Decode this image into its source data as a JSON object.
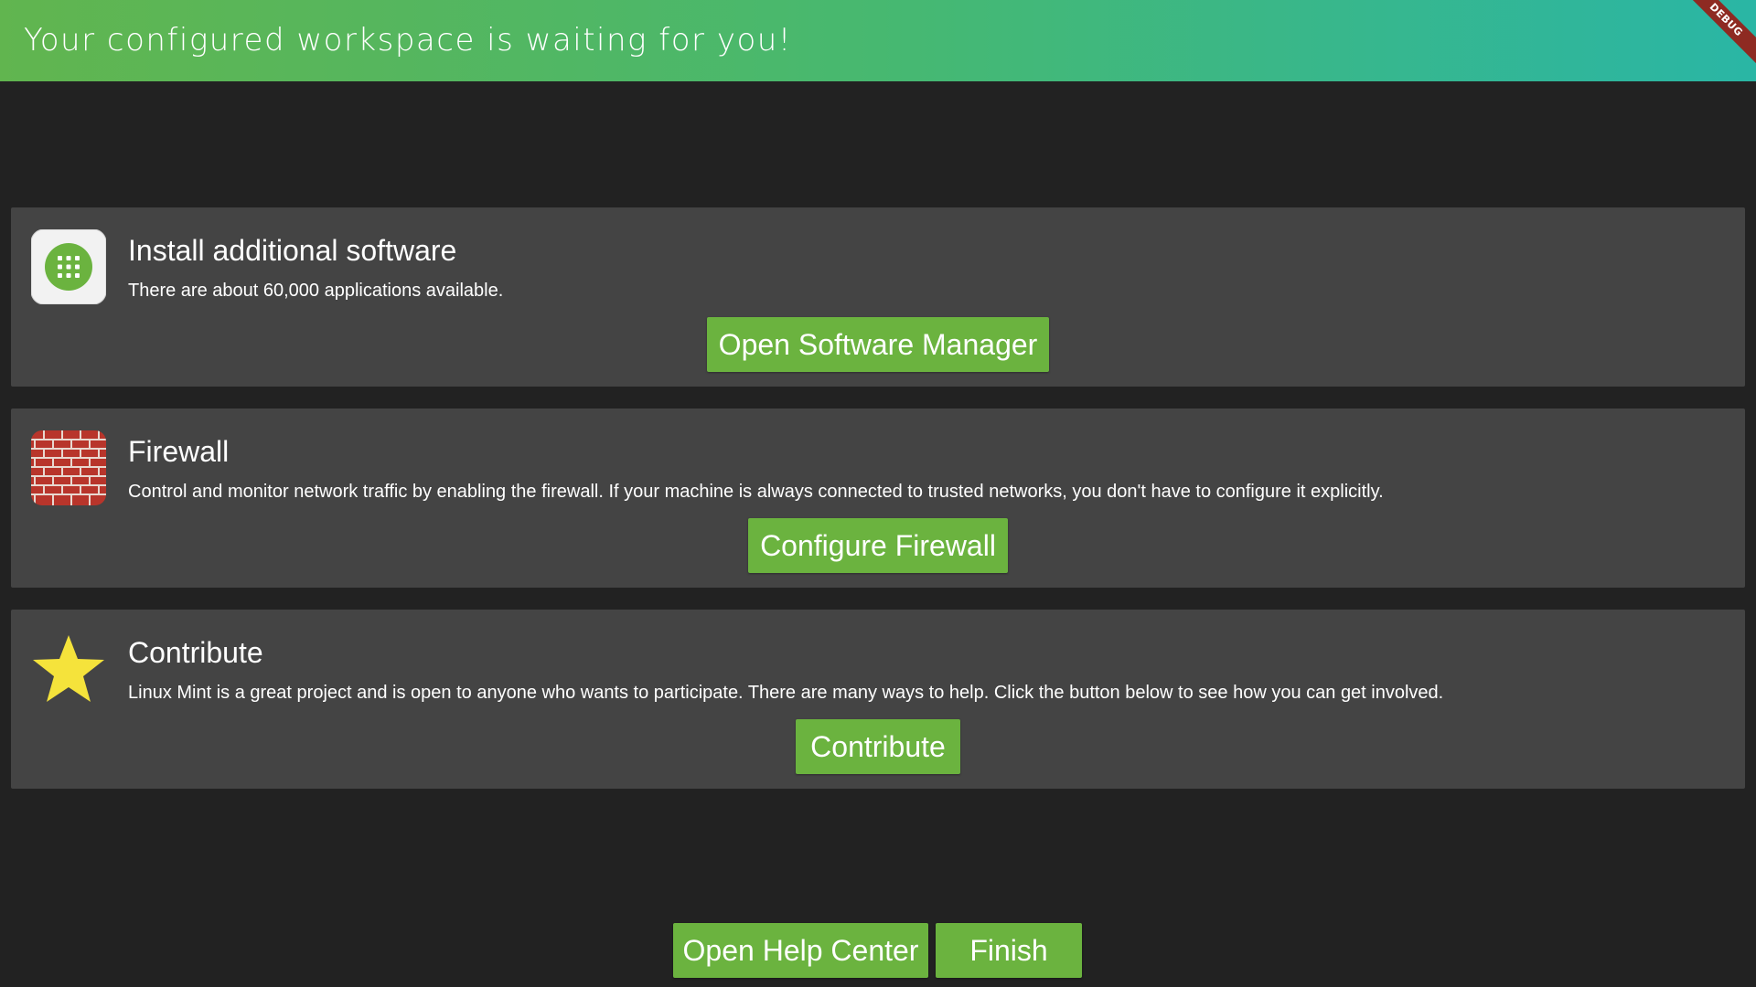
{
  "header": {
    "title": "Your configured workspace is waiting for you!",
    "debug_label": "DEBUG"
  },
  "cards": [
    {
      "icon": "software-manager-icon",
      "title": "Install additional software",
      "description": "There are about 60,000 applications available.",
      "button_label": "Open Software Manager"
    },
    {
      "icon": "firewall-brick-wall-icon",
      "title": "Firewall",
      "description": "Control and monitor network traffic by enabling the firewall. If your machine is always connected to trusted networks, you don't have to configure it explicitly.",
      "button_label": "Configure Firewall"
    },
    {
      "icon": "star-icon",
      "title": "Contribute",
      "description": "Linux Mint is a great project and is open to anyone who wants to participate. There are many ways to help. Click the button below to see how you can get involved.",
      "button_label": "Contribute"
    }
  ],
  "footer": {
    "help_label": "Open Help Center",
    "finish_label": "Finish"
  },
  "colors": {
    "accent_green": "#6bb33f",
    "header_gradient_start": "#61b54f",
    "header_gradient_end": "#2ab6a5",
    "card_background": "#444444",
    "page_background": "#222222"
  }
}
